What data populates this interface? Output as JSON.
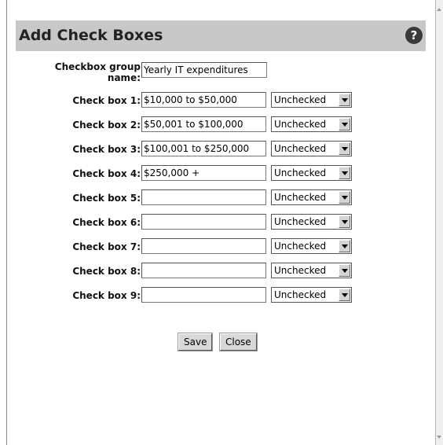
{
  "dialog": {
    "title": "Add Check Boxes",
    "help_icon": "help-icon"
  },
  "group": {
    "label_line1": "Checkbox group",
    "label_line2": "name:",
    "value": "Yearly IT expenditures"
  },
  "checkboxes": [
    {
      "label": "Check box 1:",
      "value": "$10,000 to $50,000",
      "state": "Unchecked"
    },
    {
      "label": "Check box 2:",
      "value": "$50,001 to $100,000",
      "state": "Unchecked"
    },
    {
      "label": "Check box 3:",
      "value": "$100,001 to $250,000",
      "state": "Unchecked"
    },
    {
      "label": "Check box 4:",
      "value": "$250,000 +",
      "state": "Unchecked"
    },
    {
      "label": "Check box 5:",
      "value": "",
      "state": "Unchecked"
    },
    {
      "label": "Check box 6:",
      "value": "",
      "state": "Unchecked"
    },
    {
      "label": "Check box 7:",
      "value": "",
      "state": "Unchecked"
    },
    {
      "label": "Check box 8:",
      "value": "",
      "state": "Unchecked"
    },
    {
      "label": "Check box 9:",
      "value": "",
      "state": "Unchecked"
    }
  ],
  "buttons": {
    "save": "Save",
    "close": "Close"
  }
}
